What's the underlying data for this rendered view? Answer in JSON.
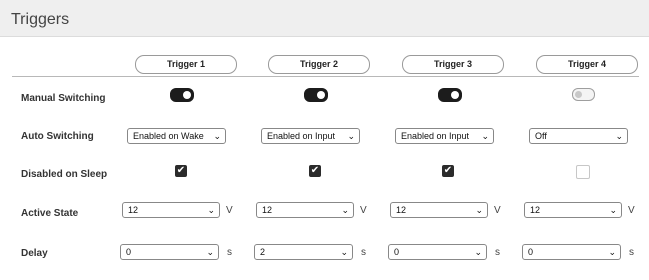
{
  "panel": {
    "title": "Triggers"
  },
  "columns": [
    "Trigger 1",
    "Trigger 2",
    "Trigger 3",
    "Trigger 4"
  ],
  "rows": {
    "manual_switching": {
      "label": "Manual Switching",
      "values": [
        true,
        true,
        true,
        false
      ]
    },
    "auto_switching": {
      "label": "Auto Switching",
      "values": [
        "Enabled on Wake",
        "Enabled on Input",
        "Enabled on Input",
        "Off"
      ]
    },
    "disabled_on_sleep": {
      "label": "Disabled on Sleep",
      "values": [
        true,
        true,
        true,
        false
      ]
    },
    "active_state": {
      "label": "Active State",
      "values": [
        "12",
        "12",
        "12",
        "12"
      ],
      "unit": "V"
    },
    "delay": {
      "label": "Delay",
      "values": [
        "0",
        "2",
        "0",
        "0"
      ],
      "unit": "s"
    }
  },
  "icons": {
    "dropdown": "chevron-down-icon",
    "check": "checkmark-icon"
  },
  "symbols": {
    "chevron": "⌄",
    "check": "✔"
  }
}
